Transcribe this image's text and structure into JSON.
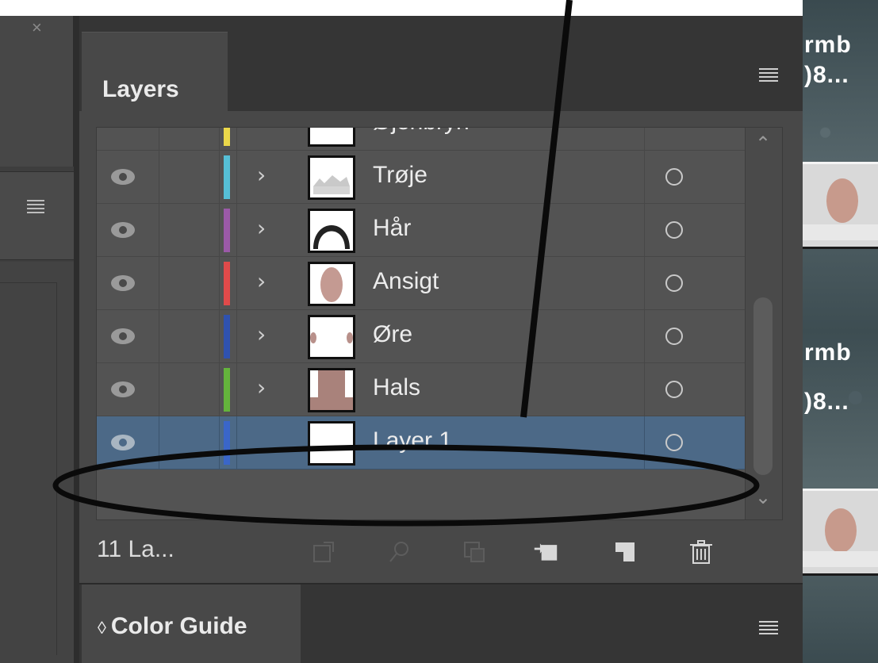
{
  "left_dock": {
    "close_glyph": "×"
  },
  "background_strip": {
    "text_1": "rmb",
    "text_2": ")8...",
    "text_3": "rmb",
    "text_4": ")8..."
  },
  "layers_panel": {
    "tab_title": "Layers",
    "partial_top_layer": "Øjenbryn",
    "layers": [
      {
        "name": "Trøje",
        "color": "#56bfd6",
        "has_children": true,
        "selected": false
      },
      {
        "name": "Hår",
        "color": "#9b5aa8",
        "has_children": true,
        "selected": false
      },
      {
        "name": "Ansigt",
        "color": "#e04a4a",
        "has_children": true,
        "selected": false
      },
      {
        "name": "Øre",
        "color": "#2f52b0",
        "has_children": true,
        "selected": false
      },
      {
        "name": "Hals",
        "color": "#64b43c",
        "has_children": true,
        "selected": false
      },
      {
        "name": "Layer 1",
        "color": "#3a66c9",
        "has_children": false,
        "selected": true
      }
    ],
    "layer_count": "11 La...",
    "chevron_glyph": "›",
    "scroll_up_glyph": "⌃",
    "scroll_down_glyph": "⌄"
  },
  "color_guide_panel": {
    "tab_title": "Color Guide",
    "tab_glyph": "◊"
  },
  "colors": {
    "selected_row": "#4c6987",
    "annotation": "#0a0a0a",
    "top_stub": "#ebd84a"
  }
}
